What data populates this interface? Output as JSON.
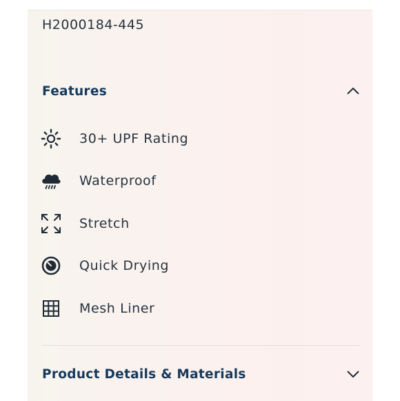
{
  "product": {
    "sku": "H2000184-445"
  },
  "features_section": {
    "title": "Features",
    "expanded": true,
    "items": [
      {
        "label": "30+ UPF Rating",
        "icon": "sun-icon"
      },
      {
        "label": "Waterproof",
        "icon": "rain-cloud-icon"
      },
      {
        "label": "Stretch",
        "icon": "expand-arrows-icon"
      },
      {
        "label": "Quick Drying",
        "icon": "timer-icon"
      },
      {
        "label": "Mesh Liner",
        "icon": "grid-icon"
      }
    ]
  },
  "details_section": {
    "title": "Product Details & Materials",
    "expanded": false
  },
  "colors": {
    "heading": "#17395b",
    "text": "#26333f",
    "icon": "#1f2a36"
  }
}
